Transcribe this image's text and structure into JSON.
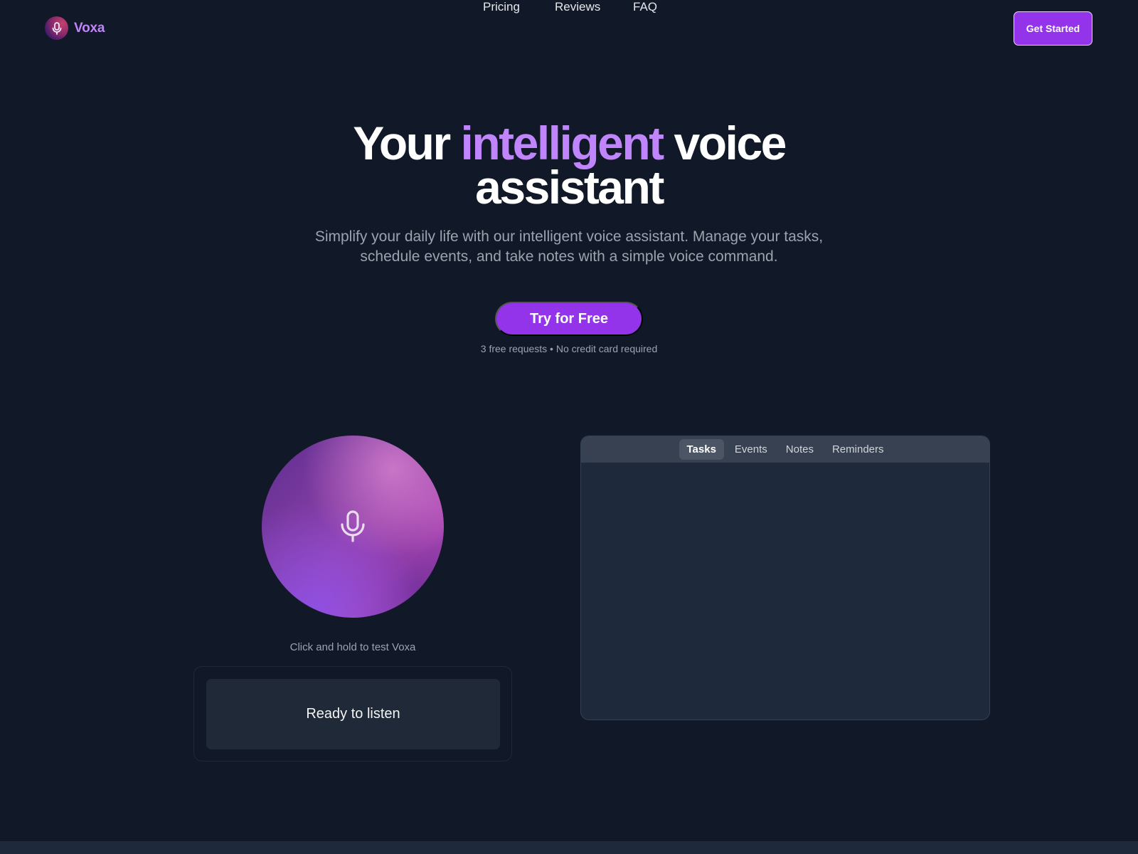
{
  "brand": {
    "name": "Voxa",
    "accent_color": "#c084fc",
    "primary_color": "#9333ea"
  },
  "nav": {
    "links": [
      {
        "label": "Pricing"
      },
      {
        "label": "Reviews"
      },
      {
        "label": "FAQ"
      }
    ],
    "cta_label": "Get Started"
  },
  "hero": {
    "title_before": "Your ",
    "title_accent": "intelligent",
    "title_after": " voice assistant",
    "subtitle": "Simplify your daily life with our intelligent voice assistant. Manage your tasks, schedule events, and take notes with a simple voice command.",
    "cta_label": "Try for Free",
    "cta_note": "3 free requests • No credit card required"
  },
  "demo": {
    "mic_icon": "microphone-icon",
    "hint": "Click and hold to test Voxa",
    "status": "Ready to listen"
  },
  "panel": {
    "tabs": [
      {
        "label": "Tasks",
        "active": true
      },
      {
        "label": "Events",
        "active": false
      },
      {
        "label": "Notes",
        "active": false
      },
      {
        "label": "Reminders",
        "active": false
      }
    ]
  }
}
